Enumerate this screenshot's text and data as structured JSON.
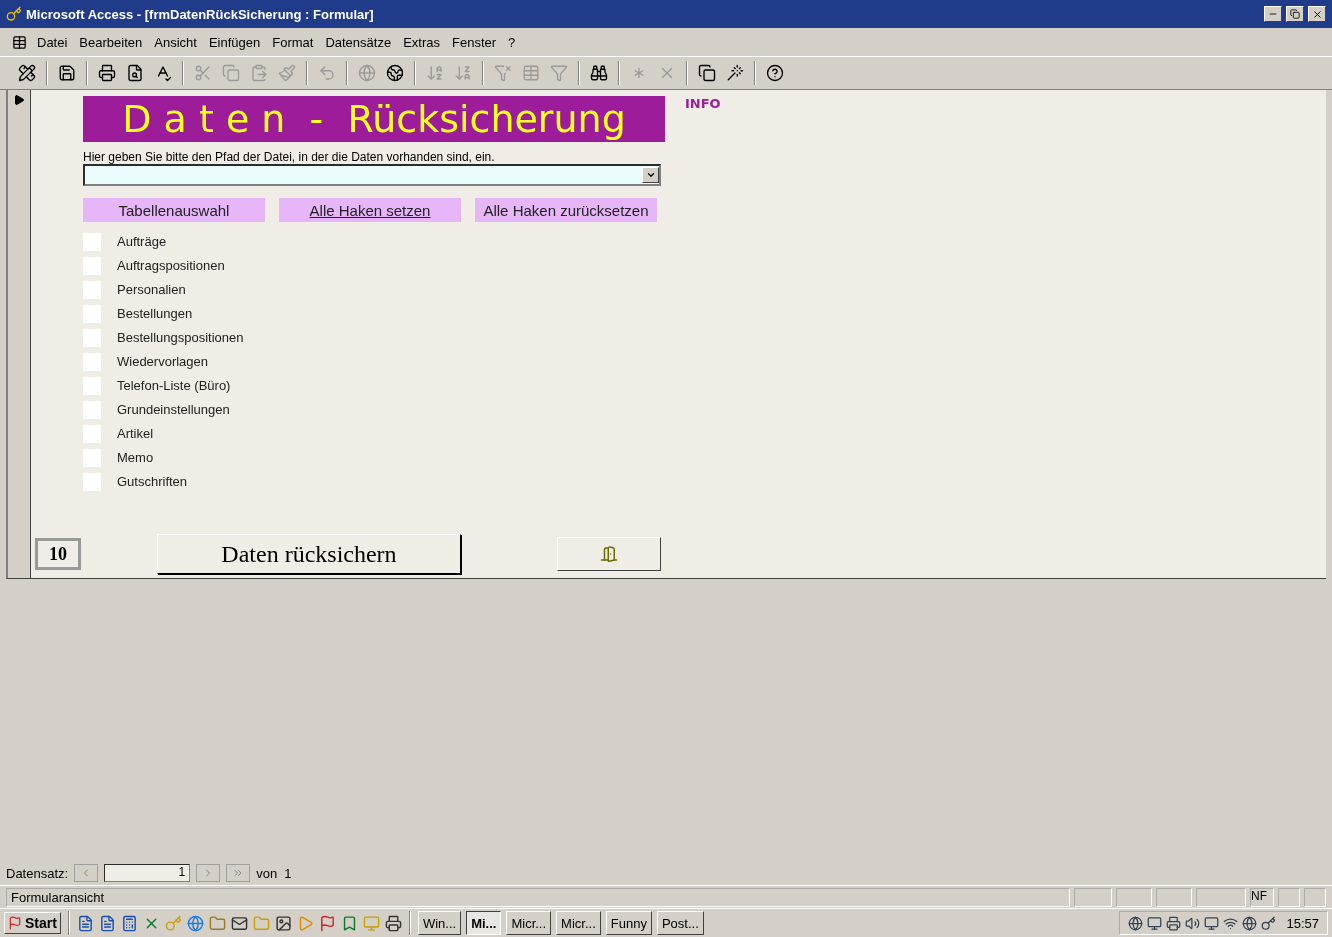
{
  "window": {
    "title": "Microsoft Access - [frmDatenRückSicherung : Formular]"
  },
  "menu": [
    {
      "label": "Datei"
    },
    {
      "label": "Bearbeiten"
    },
    {
      "label": "Ansicht"
    },
    {
      "label": "Einfügen"
    },
    {
      "label": "Format"
    },
    {
      "label": "Datensätze"
    },
    {
      "label": "Extras"
    },
    {
      "label": "Fenster"
    },
    {
      "label": "?"
    }
  ],
  "form": {
    "heading": "D a t e n  -  Rücksicherung",
    "info_link": "INFO",
    "path_label": "Hier geben Sie bitte den Pfad der Datei, in der die Daten vorhanden sind, ein.",
    "buttons": [
      {
        "label": "Tabellenauswahl",
        "kind": "plain"
      },
      {
        "label": "Alle Haken setzen",
        "kind": "link"
      },
      {
        "label": "Alle Haken zurücksetzen",
        "kind": "plain"
      }
    ],
    "tables": [
      {
        "label": "Aufträge",
        "checked": false
      },
      {
        "label": "Auftragspositionen",
        "checked": false
      },
      {
        "label": "Personalien",
        "checked": false
      },
      {
        "label": "Bestellungen",
        "checked": false
      },
      {
        "label": "Bestellungspositionen",
        "checked": false
      },
      {
        "label": "Wiedervorlagen",
        "checked": false
      },
      {
        "label": "Telefon-Liste (Büro)",
        "checked": false
      },
      {
        "label": "Grundeinstellungen",
        "checked": false
      },
      {
        "label": "Artikel",
        "checked": false
      },
      {
        "label": "Memo",
        "checked": false
      },
      {
        "label": "Gutschriften",
        "checked": false
      }
    ],
    "logo": "10",
    "restore_button": "Daten rücksichern"
  },
  "navigation": {
    "label": "Datensatz:",
    "current": "1",
    "total": "von  1"
  },
  "status_bar": {
    "text": "Formularansicht",
    "indicators": [
      "NF"
    ]
  },
  "taskbar": {
    "start": "Start",
    "tasks": [
      {
        "label": "Win...",
        "selected": false
      },
      {
        "label": "Mi...",
        "selected": true
      },
      {
        "label": "Micr...",
        "selected": false
      },
      {
        "label": "Micr...",
        "selected": false
      },
      {
        "label": "Funny",
        "selected": false
      },
      {
        "label": "Post...",
        "selected": false
      }
    ],
    "clock": "15:57"
  }
}
